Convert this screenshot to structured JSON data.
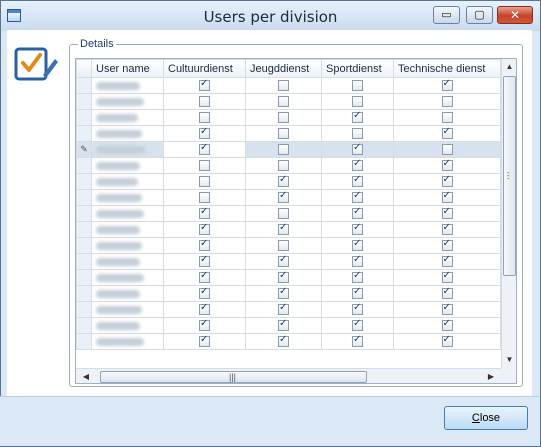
{
  "window": {
    "title": "Users per division"
  },
  "titlebar_buttons": {
    "minimize": "▭",
    "maximize": "▢",
    "close": "✕"
  },
  "group": {
    "legend": "Details"
  },
  "grid": {
    "columns": [
      "User name",
      "Cultuurdienst",
      "Jeugddienst",
      "Sportdienst",
      "Technische dienst"
    ],
    "current_row_index": 4,
    "rows": [
      [
        true,
        false,
        false,
        true
      ],
      [
        false,
        false,
        false,
        false
      ],
      [
        false,
        false,
        true,
        false
      ],
      [
        true,
        false,
        false,
        true
      ],
      [
        true,
        false,
        true,
        false
      ],
      [
        false,
        false,
        true,
        true
      ],
      [
        false,
        true,
        true,
        true
      ],
      [
        false,
        true,
        true,
        true
      ],
      [
        true,
        false,
        true,
        true
      ],
      [
        true,
        true,
        true,
        true
      ],
      [
        true,
        false,
        true,
        true
      ],
      [
        true,
        true,
        true,
        true
      ],
      [
        true,
        true,
        true,
        true
      ],
      [
        true,
        true,
        true,
        true
      ],
      [
        true,
        true,
        true,
        true
      ],
      [
        true,
        true,
        true,
        true
      ],
      [
        true,
        true,
        true,
        true
      ]
    ]
  },
  "footer": {
    "close_label": "lose",
    "close_accel": "C"
  }
}
